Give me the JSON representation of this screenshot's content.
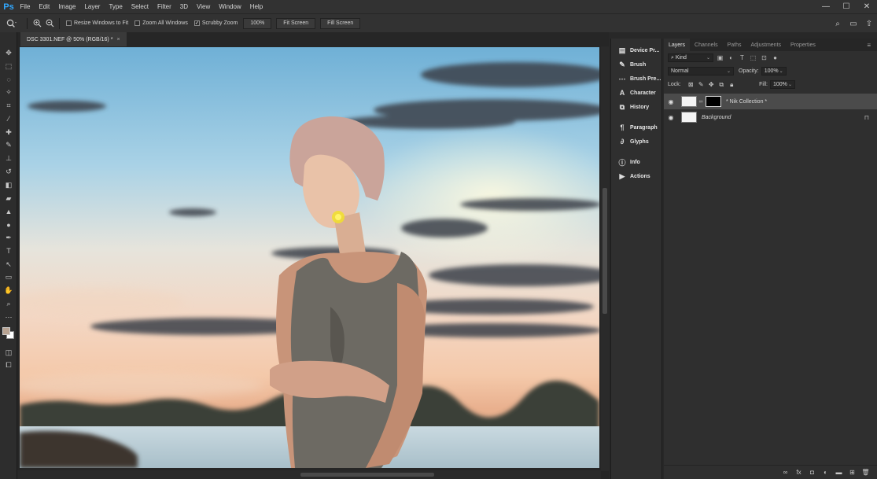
{
  "app": {
    "logo": "Ps"
  },
  "menu": [
    "File",
    "Edit",
    "Image",
    "Layer",
    "Type",
    "Select",
    "Filter",
    "3D",
    "View",
    "Window",
    "Help"
  ],
  "window_controls": {
    "minimize": "—",
    "maximize": "☐",
    "close": "✕"
  },
  "options": {
    "tool_icon": "zoom-icon",
    "resize_windows_label": "Resize Windows to Fit",
    "resize_windows_checked": false,
    "zoom_all_label": "Zoom All Windows",
    "zoom_all_checked": false,
    "scrubby_label": "Scrubby Zoom",
    "scrubby_checked": true,
    "zoom_value": "100%",
    "fit_screen": "Fit Screen",
    "fill_screen": "Fill Screen"
  },
  "document": {
    "tab_title": "DSC 3301.NEF @ 50% (RGB/16) *",
    "close": "×"
  },
  "dock": [
    {
      "icon": "device-preview-icon",
      "glyph": "▤",
      "label": "Device Pr..."
    },
    {
      "icon": "brush-icon",
      "glyph": "✎",
      "label": "Brush"
    },
    {
      "icon": "brush-presets-icon",
      "glyph": "⋯",
      "label": "Brush Pre..."
    },
    {
      "icon": "character-icon",
      "glyph": "A",
      "label": "Character"
    },
    {
      "icon": "history-icon",
      "glyph": "⧉",
      "label": "History"
    },
    {
      "icon": "paragraph-icon",
      "glyph": "¶",
      "label": "Paragraph"
    },
    {
      "icon": "glyphs-icon",
      "glyph": "∂",
      "label": "Glyphs"
    },
    {
      "icon": "info-icon",
      "glyph": "ⓘ",
      "label": "Info"
    },
    {
      "icon": "actions-icon",
      "glyph": "▶",
      "label": "Actions"
    }
  ],
  "panel": {
    "tabs": [
      "Layers",
      "Channels",
      "Paths",
      "Adjustments",
      "Properties"
    ],
    "active_tab": "Layers",
    "filter_kind": "Kind",
    "blend_mode": "Normal",
    "opacity_label": "Opacity:",
    "opacity_value": "100%",
    "lock_label": "Lock:",
    "fill_label": "Fill:",
    "fill_value": "100%",
    "layers": [
      {
        "name": "* Nik Collection *",
        "visible": true,
        "selected": true,
        "has_mask": true
      },
      {
        "name": "Background",
        "visible": true,
        "selected": false,
        "locked": true
      }
    ]
  },
  "colors": {
    "foreground": "#b8a392",
    "background": "#ffffff",
    "accent": "#31a8ff"
  }
}
